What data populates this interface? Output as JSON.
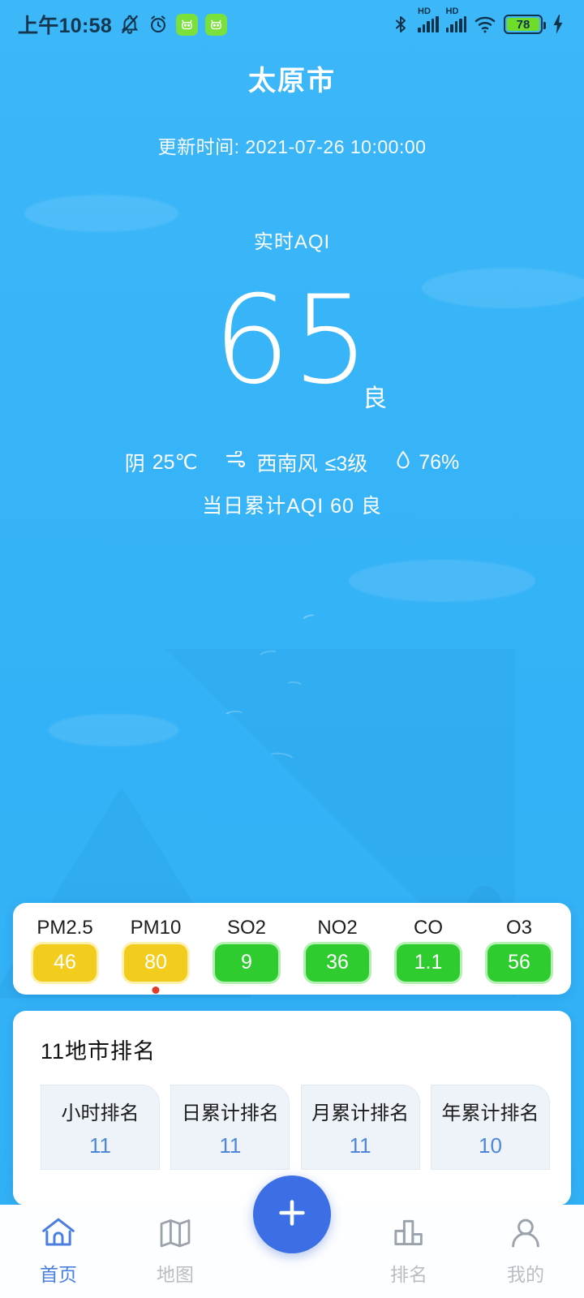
{
  "statusbar": {
    "time": "上午10:58",
    "icons_left": [
      "bell-muted-icon",
      "alarm-clock-icon",
      "app-badge-icon",
      "app-badge-icon"
    ],
    "icons_right": [
      "bluetooth-icon",
      "hd-signal-icon",
      "hd-signal-icon",
      "wifi-icon",
      "battery-icon",
      "charging-bolt-icon"
    ],
    "hd_label": "HD",
    "battery_level": "78"
  },
  "header": {
    "city": "太原市",
    "updated": "更新时间: 2021-07-26 10:00:00"
  },
  "aqi": {
    "label": "实时AQI",
    "value": "65",
    "quality": "良",
    "weather_condition": "阴",
    "temperature": "25℃",
    "wind_direction": "西南风",
    "wind_level": "≤3级",
    "humidity": "76%",
    "daily_cumulative": "当日累计AQI  60  良"
  },
  "pollutants": {
    "items": [
      {
        "name": "PM2.5",
        "value": "46",
        "level": "moderate",
        "primary": false
      },
      {
        "name": "PM10",
        "value": "80",
        "level": "moderate",
        "primary": true
      },
      {
        "name": "SO2",
        "value": "9",
        "level": "good",
        "primary": false
      },
      {
        "name": "NO2",
        "value": "36",
        "level": "good",
        "primary": false
      },
      {
        "name": "CO",
        "value": "1.1",
        "level": "good",
        "primary": false
      },
      {
        "name": "O3",
        "value": "56",
        "level": "good",
        "primary": false
      }
    ]
  },
  "ranking": {
    "title": "11地市排名",
    "tiles": [
      {
        "label": "小时排名",
        "value": "11"
      },
      {
        "label": "日累计排名",
        "value": "11"
      },
      {
        "label": "月累计排名",
        "value": "11"
      },
      {
        "label": "年累计排名",
        "value": "10"
      }
    ]
  },
  "nav": {
    "items": [
      {
        "label": "首页",
        "icon": "home-icon",
        "active": true
      },
      {
        "label": "地图",
        "icon": "map-icon",
        "active": false
      },
      {
        "label": "排名",
        "icon": "bar-chart-icon",
        "active": false
      },
      {
        "label": "我的",
        "icon": "person-icon",
        "active": false
      }
    ],
    "fab_icon": "plus-icon"
  },
  "colors": {
    "sky": "#36b4f7",
    "good": "#2ecc2e",
    "moderate": "#f2cd1e",
    "accent_blue": "#4a7fe0",
    "fab": "#3c6fe6",
    "primary_dot": "#e23b2e"
  }
}
